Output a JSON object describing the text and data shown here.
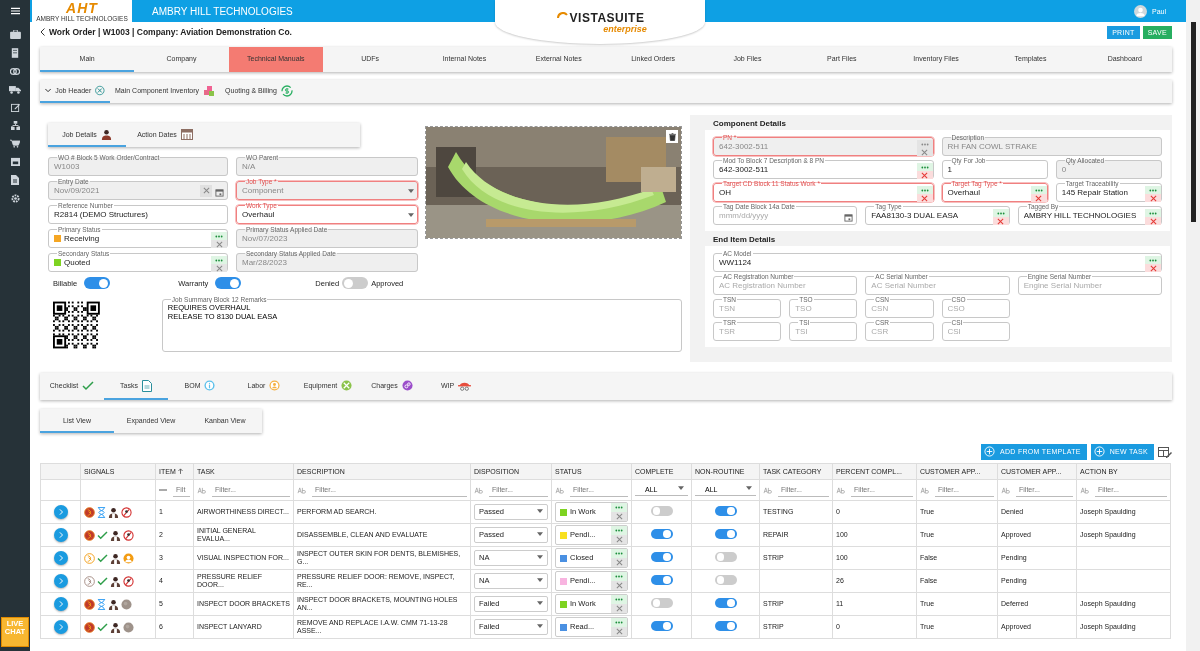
{
  "app": {
    "brand": "AMBRY HILL TECHNOLOGIES",
    "logo_letters": "AHT",
    "logo_caption": "AMBRY HILL TECHNOLOGIES",
    "product": "VISTASUITE",
    "edition": "enterprise",
    "user": "Paul"
  },
  "sidebar": {
    "live_chat": "LIVE CHAT"
  },
  "page": {
    "title": "Work Order | W1003 | Company: Aviation Demonstration Co.",
    "actions": [
      {
        "label": "PRINT",
        "kind": "primary"
      },
      {
        "label": "SAVE",
        "kind": "success"
      }
    ]
  },
  "tabs": [
    {
      "label": "Main",
      "selected": true,
      "flagged": false
    },
    {
      "label": "Company",
      "selected": false,
      "flagged": false
    },
    {
      "label": "Technical Manuals",
      "selected": false,
      "flagged": true
    },
    {
      "label": "UDFs",
      "selected": false,
      "flagged": false
    },
    {
      "label": "Internal Notes",
      "selected": false,
      "flagged": false
    },
    {
      "label": "External Notes",
      "selected": false,
      "flagged": false
    },
    {
      "label": "Linked Orders",
      "selected": false,
      "flagged": false
    },
    {
      "label": "Job Files",
      "selected": false,
      "flagged": false
    },
    {
      "label": "Part Files",
      "selected": false,
      "flagged": false
    },
    {
      "label": "Inventory Files",
      "selected": false,
      "flagged": false
    },
    {
      "label": "Templates",
      "selected": false,
      "flagged": false
    },
    {
      "label": "Dashboard",
      "selected": false,
      "flagged": false
    }
  ],
  "sections": [
    {
      "label": "Job Header",
      "selected": true,
      "expanded": true
    },
    {
      "label": "Main Component Inventory",
      "selected": false,
      "expanded": false
    },
    {
      "label": "Quoting & Billing",
      "selected": false,
      "expanded": false
    }
  ],
  "job_details": {
    "tabs": [
      {
        "label": "Job Details",
        "selected": true
      },
      {
        "label": "Action Dates",
        "selected": false
      }
    ],
    "fields": [
      {
        "label": "WO # Block 5 Work Order/Contract",
        "value": "W1003",
        "kind": "text",
        "required": false,
        "disabled": true
      },
      {
        "label": "WO Parent",
        "value": "N/A",
        "kind": "text",
        "required": false,
        "disabled": true
      },
      {
        "label": "Entry Date",
        "value": "Nov/09/2021",
        "kind": "date-clear",
        "required": false,
        "disabled": true
      },
      {
        "label": "Job Type *",
        "value": "Component",
        "kind": "select",
        "required": true,
        "disabled": true
      },
      {
        "label": "Reference Number",
        "value": "R2814 (DEMO Structures)",
        "kind": "text",
        "required": false,
        "disabled": false
      },
      {
        "label": "Work Type",
        "value": "Overhaul",
        "kind": "select",
        "required": true,
        "disabled": false
      },
      {
        "label": "Primary Status",
        "value": "Receiving",
        "kind": "lookup",
        "required": false,
        "disabled": false,
        "color": "#f5a623"
      },
      {
        "label": "Primary Status Applied Date",
        "value": "Nov/07/2023",
        "kind": "text",
        "required": false,
        "disabled": true
      },
      {
        "label": "Secondary Status",
        "value": "Quoted",
        "kind": "lookup",
        "required": false,
        "disabled": false,
        "color": "#7ed321"
      },
      {
        "label": "Secondary Status Applied Date",
        "value": "Mar/28/2023",
        "kind": "text",
        "required": false,
        "disabled": true
      }
    ],
    "toggles": [
      {
        "label": "Billable",
        "on": true
      },
      {
        "label": "Warranty",
        "on": true
      }
    ],
    "approval": {
      "off_label": "Denied",
      "on_label": "Approved",
      "on": false
    },
    "summary": {
      "label": "Job Summary Block 12 Remarks",
      "value": "REQUIRES OVERHAUL\nRELEASE TO 8130 DUAL EASA"
    }
  },
  "component": {
    "title": "Component Details",
    "fields": [
      {
        "label": "PN *",
        "value": "642-3002-511",
        "kind": "lookup",
        "required": true,
        "disabled": true
      },
      {
        "label": "Description",
        "value": "RH FAN COWL STRAKE",
        "kind": "text",
        "required": false,
        "disabled": true
      },
      {
        "label": "Mod To Block 7 Description & 8 PN",
        "value": "642-3002-511",
        "kind": "lookup",
        "required": false,
        "disabled": false
      },
      {
        "label": "Qty For Job",
        "value": "1",
        "kind": "text",
        "required": false,
        "disabled": false
      },
      {
        "label": "Qty Allocated",
        "value": "0",
        "kind": "text",
        "required": false,
        "disabled": true
      },
      {
        "label": "Target CD Block 11 Status Work *",
        "value": "OH",
        "kind": "lookup",
        "required": true,
        "disabled": false
      },
      {
        "label": "Target Tag Type *",
        "value": "Overhaul",
        "kind": "lookup",
        "required": true,
        "disabled": false
      },
      {
        "label": "Target Traceability",
        "value": "145 Repair Station",
        "kind": "lookup",
        "required": false,
        "disabled": false
      },
      {
        "label": "Tag Date Block 14a Date",
        "placeholder": "mmm/dd/yyyy",
        "kind": "date",
        "required": false,
        "disabled": false
      },
      {
        "label": "Tag Type",
        "value": "FAA8130-3 DUAL EASA",
        "kind": "lookup",
        "required": false,
        "disabled": false
      },
      {
        "label": "Tagged By",
        "value": "AMBRY HILL TECHNOLOGIES",
        "kind": "lookup",
        "required": false,
        "disabled": false
      }
    ]
  },
  "end_item": {
    "title": "End Item Details",
    "fields": [
      {
        "label": "AC Model",
        "value": "WW1124",
        "kind": "lookup",
        "required": false,
        "disabled": false
      },
      {
        "label": "AC Registration Number",
        "placeholder": "AC Registration Number",
        "kind": "text",
        "required": false,
        "disabled": false
      },
      {
        "label": "AC Serial Number",
        "placeholder": "AC Serial Number",
        "kind": "text",
        "required": false,
        "disabled": false
      },
      {
        "label": "Engine Serial Number",
        "placeholder": "Engine Serial Number",
        "kind": "text",
        "required": false,
        "disabled": false
      }
    ],
    "times": [
      {
        "label": "TSN",
        "placeholder": "TSN",
        "kind": "text",
        "required": false,
        "disabled": false
      },
      {
        "label": "TSO",
        "placeholder": "TSO",
        "kind": "text",
        "required": false,
        "disabled": false
      },
      {
        "label": "CSN",
        "placeholder": "CSN",
        "kind": "text",
        "required": false,
        "disabled": false
      },
      {
        "label": "CSO",
        "placeholder": "CSO",
        "kind": "text",
        "required": false,
        "disabled": false
      },
      {
        "label": "TSR",
        "placeholder": "TSR",
        "kind": "text",
        "required": false,
        "disabled": false
      },
      {
        "label": "TSI",
        "placeholder": "TSI",
        "kind": "text",
        "required": false,
        "disabled": false
      },
      {
        "label": "CSR",
        "placeholder": "CSR",
        "kind": "text",
        "required": false,
        "disabled": false
      },
      {
        "label": "CSI",
        "placeholder": "CSI",
        "kind": "text",
        "required": false,
        "disabled": false
      }
    ]
  },
  "detail_tabs": [
    {
      "label": "Checklist",
      "selected": false
    },
    {
      "label": "Tasks",
      "selected": true
    },
    {
      "label": "BOM",
      "selected": false
    },
    {
      "label": "Labor",
      "selected": false
    },
    {
      "label": "Equipment",
      "selected": false
    },
    {
      "label": "Charges",
      "selected": false
    },
    {
      "label": "WIP",
      "selected": false
    }
  ],
  "views": [
    {
      "label": "List View",
      "selected": true
    },
    {
      "label": "Expanded View",
      "selected": false
    },
    {
      "label": "Kanban View",
      "selected": false
    }
  ],
  "toolbar": [
    "ADD FROM TEMPLATE",
    "NEW TASK"
  ],
  "table": {
    "columns": [
      {
        "label": "SIGNALS",
        "sorted": false,
        "filter": {
          "kind": "none"
        }
      },
      {
        "label": "ITEM",
        "sorted": true,
        "filter": {
          "kind": "number",
          "placeholder": "Filt"
        }
      },
      {
        "label": "TASK",
        "sorted": false,
        "filter": {
          "kind": "text",
          "placeholder": "Filter..."
        }
      },
      {
        "label": "DESCRIPTION",
        "sorted": false,
        "filter": {
          "kind": "text",
          "placeholder": "Filter..."
        }
      },
      {
        "label": "DISPOSITION",
        "sorted": false,
        "filter": {
          "kind": "text",
          "placeholder": "Filter..."
        }
      },
      {
        "label": "STATUS",
        "sorted": false,
        "filter": {
          "kind": "text",
          "placeholder": "Filter..."
        }
      },
      {
        "label": "COMPLETE",
        "sorted": false,
        "filter": {
          "kind": "select",
          "value": "ALL"
        }
      },
      {
        "label": "NON-ROUTINE",
        "sorted": false,
        "filter": {
          "kind": "select",
          "value": "ALL"
        }
      },
      {
        "label": "TASK CATEGORY",
        "sorted": false,
        "filter": {
          "kind": "text",
          "placeholder": "Filter..."
        }
      },
      {
        "label": "PERCENT COMPL...",
        "sorted": false,
        "filter": {
          "kind": "text",
          "placeholder": "Filter..."
        }
      },
      {
        "label": "CUSTOMER APP...",
        "sorted": false,
        "filter": {
          "kind": "text",
          "placeholder": "Filter..."
        }
      },
      {
        "label": "CUSTOMER APP...",
        "sorted": false,
        "filter": {
          "kind": "text",
          "placeholder": "Filter..."
        }
      },
      {
        "label": "ACTION BY",
        "sorted": false,
        "filter": {
          "kind": "text",
          "placeholder": "Filter..."
        }
      }
    ],
    "rows": [
      {
        "signals": [
          {
            "kind": "red-seal"
          },
          {
            "kind": "hourglass"
          },
          {
            "kind": "mechanic"
          },
          {
            "kind": "no-entry"
          }
        ],
        "item": "1",
        "task": "AIRWORTHINESS DIRECT...",
        "description": "PERFORM AD SEARCH.",
        "disposition": "Passed",
        "status": "In Work",
        "color": "#7ed321",
        "complete": false,
        "non_routine": true,
        "category": "TESTING",
        "percent": "0",
        "customer_app_1": "True",
        "customer_app_2": "Denied",
        "action_by": "Joseph Spaulding"
      },
      {
        "signals": [
          {
            "kind": "red-seal"
          },
          {
            "kind": "check"
          },
          {
            "kind": "mechanic"
          },
          {
            "kind": "no-entry"
          }
        ],
        "item": "2",
        "task": "INITIAL GENERAL EVALUA...",
        "description": "DISASSEMBLE, CLEAN AND EVALUATE",
        "disposition": "Passed",
        "status": "Pendi...",
        "color": "#f8e020",
        "complete": true,
        "non_routine": true,
        "category": "REPAIR",
        "percent": "100",
        "customer_app_1": "True",
        "customer_app_2": "Approved",
        "action_by": "Joseph Spaulding"
      },
      {
        "signals": [
          {
            "kind": "orange-seal"
          },
          {
            "kind": "check"
          },
          {
            "kind": "mechanic"
          },
          {
            "kind": "orange-user"
          }
        ],
        "item": "3",
        "task": "VISUAL INSPECTION FOR...",
        "description": "INSPECT OUTER SKIN FOR DENTS, BLEMISHES, G...",
        "disposition": "NA",
        "status": "Closed",
        "color": "#4a90e2",
        "complete": true,
        "non_routine": false,
        "category": "STRIP",
        "percent": "100",
        "customer_app_1": "False",
        "customer_app_2": "Pending"
      },
      {
        "signals": [
          {
            "kind": "grey-seal"
          },
          {
            "kind": "check"
          },
          {
            "kind": "mechanic"
          },
          {
            "kind": "no-entry"
          }
        ],
        "item": "4",
        "task": "PRESSURE RELIEF DOOR...",
        "description": "PRESSURE RELIEF DOOR: REMOVE, INSPECT, RE...",
        "disposition": "NA",
        "status": "Pendi...",
        "color": "#f8b4e0",
        "complete": true,
        "non_routine": false,
        "percent": "26",
        "customer_app_1": "False",
        "customer_app_2": "Pending"
      },
      {
        "signals": [
          {
            "kind": "red-seal"
          },
          {
            "kind": "hourglass"
          },
          {
            "kind": "mechanic"
          },
          {
            "kind": "grey-user"
          }
        ],
        "item": "5",
        "task": "INSPECT DOOR BRACKETS",
        "description": "INSPECT DOOR BRACKETS, MOUNTING HOLES AN...",
        "disposition": "Failed",
        "status": "In Work",
        "color": "#7ed321",
        "complete": false,
        "non_routine": true,
        "category": "STRIP",
        "percent": "11",
        "customer_app_1": "True",
        "customer_app_2": "Deferred",
        "action_by": "Joseph Spaulding"
      },
      {
        "signals": [
          {
            "kind": "red-seal"
          },
          {
            "kind": "check"
          },
          {
            "kind": "mechanic"
          },
          {
            "kind": "grey-user"
          }
        ],
        "item": "6",
        "task": "INSPECT LANYARD",
        "description": "REMOVE AND REPLACE I.A.W. CMM 71-13-28 ASSE...",
        "disposition": "Failed",
        "status": "Read...",
        "color": "#4a90e2",
        "complete": true,
        "non_routine": true,
        "category": "STRIP",
        "percent": "0",
        "customer_app_1": "True",
        "customer_app_2": "Approved",
        "action_by": "Joseph Spaulding"
      }
    ]
  }
}
